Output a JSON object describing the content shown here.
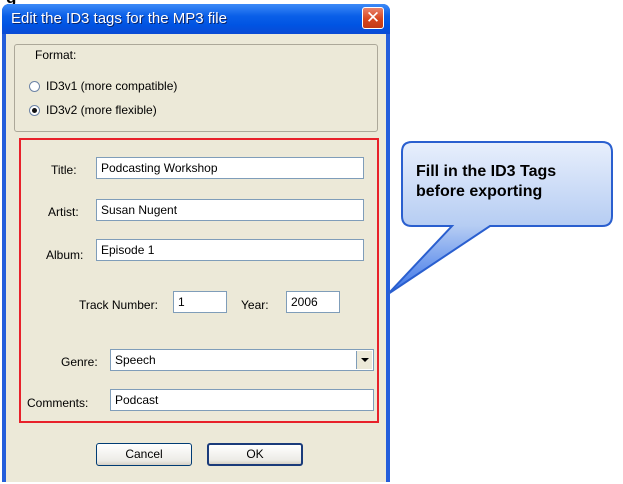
{
  "top_strip": {
    "text": "g"
  },
  "dialog": {
    "title": "Edit the ID3 tags for the MP3 file",
    "close_glyph": "✕"
  },
  "format": {
    "legend": "Format:",
    "options": [
      {
        "label": "ID3v1 (more compatible)",
        "checked": false
      },
      {
        "label": "ID3v2 (more flexible)",
        "checked": true
      }
    ]
  },
  "fields": {
    "title_label": "Title:",
    "title_value": "Podcasting Workshop",
    "artist_label": "Artist:",
    "artist_value": "Susan Nugent",
    "album_label": "Album:",
    "album_value": "Episode 1",
    "track_label": "Track Number:",
    "track_value": "1",
    "year_label": "Year:",
    "year_value": "2006",
    "genre_label": "Genre:",
    "genre_value": "Speech",
    "comments_label": "Comments:",
    "comments_value": "Podcast"
  },
  "buttons": {
    "cancel": "Cancel",
    "ok": "OK"
  },
  "callout": {
    "line1": "Fill in the ID3 Tags",
    "line2": "before exporting"
  },
  "colors": {
    "highlight": "#e8212a",
    "callout_fill": "#3a73e8",
    "title_bar": "#0054e3"
  }
}
